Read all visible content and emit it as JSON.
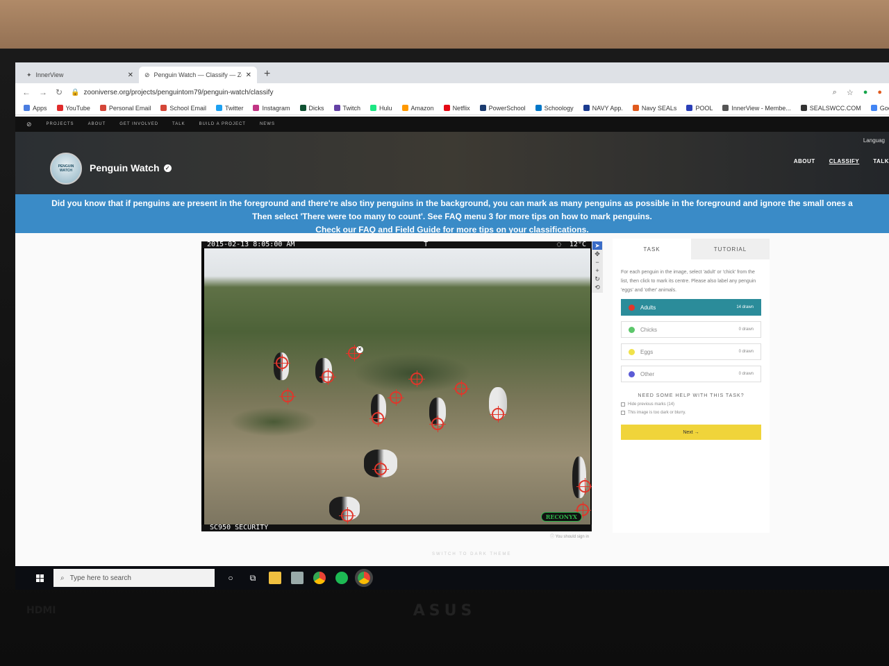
{
  "browser": {
    "tabs": [
      {
        "label": "InnerView",
        "active": false
      },
      {
        "label": "Penguin Watch — Classify — Zoo",
        "active": true
      }
    ],
    "url": "zooniverse.org/projects/penguintom79/penguin-watch/classify",
    "bookmarks": [
      "Apps",
      "YouTube",
      "Personal Email",
      "School Email",
      "Twitter",
      "Instagram",
      "Dicks",
      "Twitch",
      "Hulu",
      "Amazon",
      "Netflix",
      "PowerSchool",
      "Schoology",
      "NAVY App.",
      "Navy SEALs",
      "POOL",
      "InnerView - Membe...",
      "SEALSWCC.COM",
      "Google D"
    ]
  },
  "site_nav": [
    "PROJECTS",
    "ABOUT",
    "GET INVOLVED",
    "TALK",
    "BUILD A PROJECT",
    "NEWS"
  ],
  "project": {
    "title": "Penguin Watch",
    "logo_text": "PENGUIN WATCH",
    "language_label": "Languag",
    "nav": [
      "ABOUT",
      "CLASSIFY",
      "TALK"
    ]
  },
  "banner": {
    "line1": "Did you know that if penguins are present in the foreground and there're also tiny penguins in the background, you can mark as many penguins as possible in the foreground and ignore the small ones a",
    "line2": "Then select 'There were too many to count'. See FAQ menu 3 for more tips on how to mark penguins.",
    "line3_pre": "Check our ",
    "line3_faq": "FAQ",
    "line3_post": " and Field Guide for more tips on your classifications."
  },
  "subject": {
    "timestamp": "2015-02-13  8:05:00 AM",
    "flag": "T",
    "temperature": "12°C",
    "moon": "◌",
    "camera": "SC950 SECURITY",
    "brand": "RECONYX"
  },
  "task": {
    "tabs": [
      "TASK",
      "TUTORIAL"
    ],
    "instructions": "For each penguin in the image, select 'adult' or 'chick' from the list, then click to mark its centre. Please also label any penguin 'eggs' and 'other' animals.",
    "choices": [
      {
        "label": "Adults",
        "count": "14 drawn",
        "active": true,
        "color": "#e0362b"
      },
      {
        "label": "Chicks",
        "count": "0 drawn",
        "active": false,
        "color": "#5cc76b"
      },
      {
        "label": "Eggs",
        "count": "0 drawn",
        "active": false,
        "color": "#f0e24a"
      },
      {
        "label": "Other",
        "count": "0 drawn",
        "active": false,
        "color": "#5b5bd6"
      }
    ],
    "help_title": "NEED SOME HELP WITH THIS TASK?",
    "checkbox_hide": "Hide previous marks (14)",
    "checkbox_dark": "This image is too dark or blurry.",
    "next_label": "Next →"
  },
  "footer_note": "You should sign in",
  "dark_theme_label": "SWITCH TO DARK THEME",
  "taskbar": {
    "search_placeholder": "Type here to search"
  },
  "monitor": {
    "brand": "ASUS",
    "port": "HDMI"
  }
}
